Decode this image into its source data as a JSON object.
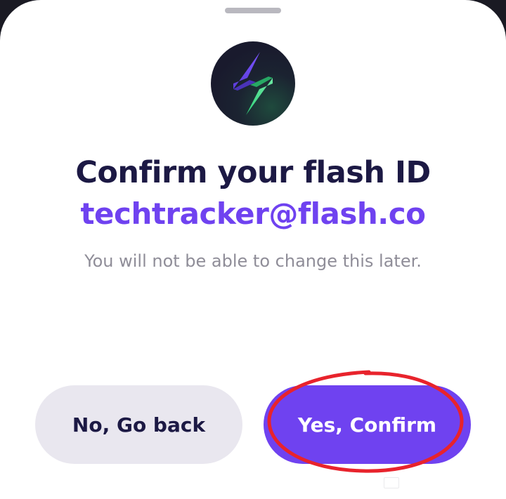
{
  "sheet": {
    "title": "Confirm your flash ID",
    "flash_id": "techtracker@flash.co",
    "notice": "You will not be able to change this later."
  },
  "actions": {
    "back_label": "No, Go back",
    "confirm_label": "Yes, Confirm"
  },
  "icons": {
    "logo": "lightning-bolt-icon",
    "handle": "drag-handle"
  },
  "colors": {
    "brand_purple": "#6f42f0",
    "title_navy": "#1c1944",
    "secondary_button": "#e9e7ef",
    "notice_gray": "#8f8d98",
    "annotation_red": "#e8232c"
  }
}
